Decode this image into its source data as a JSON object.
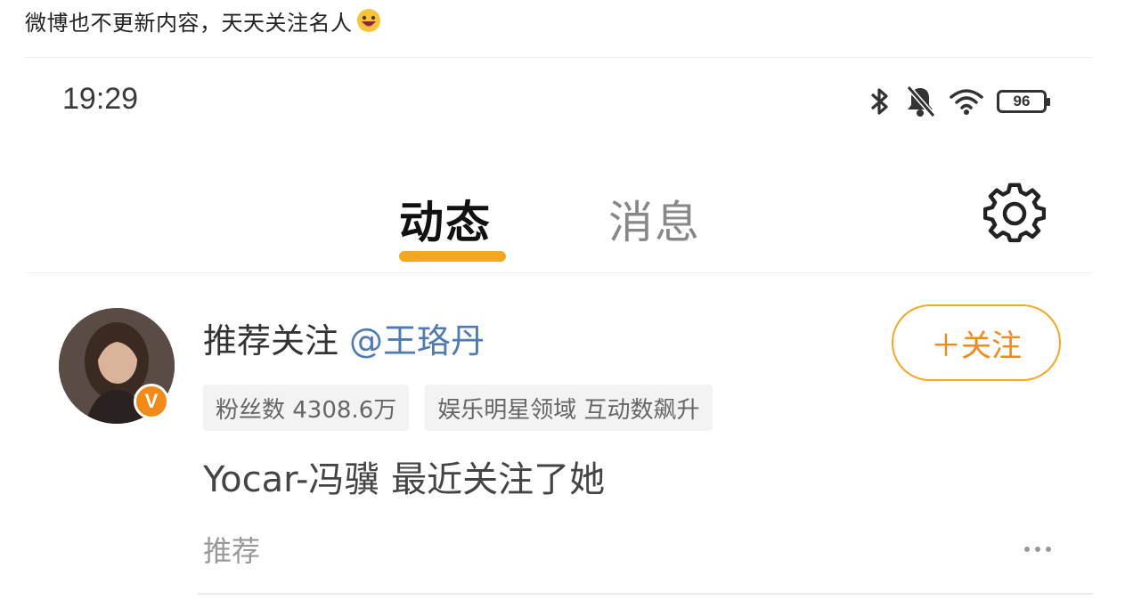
{
  "caption": {
    "text": "微博也不更新内容，天天关注名人",
    "emoji": "grinning-face-emoji"
  },
  "status_bar": {
    "time": "19:29",
    "icons": [
      "bluetooth-icon",
      "notifications-off-icon",
      "wifi-icon",
      "battery-icon"
    ],
    "battery_level": "96"
  },
  "tabs": [
    {
      "label": "动态",
      "active": true
    },
    {
      "label": "消息",
      "active": false
    }
  ],
  "settings_icon": "gear-icon",
  "recommendation": {
    "prefix": "推荐关注",
    "handle": "@王珞丹",
    "verified_badge": "V",
    "follow_label": "＋关注",
    "tags": [
      "粉丝数 4308.6万",
      "娱乐明星领域 互动数飙升"
    ],
    "reason": "Yocar-冯骥 最近关注了她",
    "footer_label": "推荐"
  },
  "colors": {
    "accent": "#f5a623",
    "follow_text": "#f28a1a",
    "handle": "#4e7bb1",
    "badge": "#f28a1a"
  }
}
